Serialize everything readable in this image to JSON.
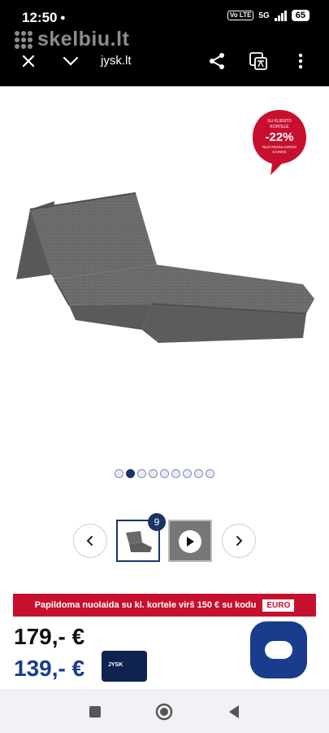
{
  "status_bar": {
    "time": "12:50",
    "volte_label": "Vo LTE",
    "network": "5G",
    "battery": "65"
  },
  "browser": {
    "watermark": "skelbiu.lt",
    "url": "jysk.lt"
  },
  "product": {
    "discount_badge": {
      "line1": "SU KLIENTO",
      "line2": "KORTELE",
      "percent": "-22%",
      "line3": "NUO REGULIARIOS",
      "line4": "KAINOS",
      "color": "#c8102e"
    },
    "gallery": {
      "dot_count": 9,
      "active_index": 1,
      "thumb_count": "9"
    },
    "promo_banner": {
      "text": "Papildoma nuolaida su kl. kortele virš 150 € su kodu",
      "code": "EURO"
    },
    "price_regular": "179,-  €",
    "price_card": "139,- €",
    "card_label": "JYSK"
  },
  "colors": {
    "brand_blue": "#1a3c8c",
    "promo_red": "#c8102e"
  }
}
